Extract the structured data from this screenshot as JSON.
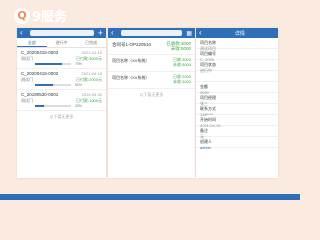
{
  "logo": {
    "mark": "Q",
    "text": "9服务"
  },
  "screen1": {
    "tabs": [
      "全部",
      "进行中",
      "已完成"
    ],
    "cards": [
      {
        "code": "C_20200415-0003",
        "date": "2021-04-15",
        "sub": "测试门",
        "amount": "已付款:3000元",
        "progress": 0.75,
        "pct": "75%"
      },
      {
        "code": "C_20200415-0002",
        "date": "2021-04-15",
        "sub": "测试门",
        "amount": "已付款:2000元",
        "progress": 0.5,
        "pct": "50%"
      },
      {
        "code": "C_20190530-0001",
        "date": "2019-05-30",
        "sub": "测试门",
        "amount": "已付款:1000元",
        "progress": 0.25,
        "pct": "25%"
      }
    ],
    "more": "以下暂无更多"
  },
  "screen2": {
    "head": {
      "title": "合同号1-OP220510",
      "right1": "已收款:3000",
      "right2": "未收:5000"
    },
    "rows": [
      {
        "label": "项目名称（XX系统）",
        "right1": "已收:3000",
        "right2": "未收:5000"
      },
      {
        "label": "项目名称（XX系统）",
        "right1": "已收:2000",
        "right2": "未收:3000"
      }
    ],
    "more": "以下暂无更多"
  },
  "screen3": {
    "title": "详情",
    "fields": [
      {
        "label": "项目名称",
        "value": "测试项目"
      },
      {
        "label": "项目编号",
        "value": "C_2020"
      },
      {
        "label": "项目状态",
        "value": "进行中"
      },
      {
        "label": "",
        "value": ""
      },
      {
        "label": "金额",
        "value": "3000"
      },
      {
        "label": "项目经理",
        "value": "张三"
      },
      {
        "label": "联系方式",
        "value": "138****"
      },
      {
        "label": "开始时间",
        "value": "2021-04-15"
      },
      {
        "label": "备注",
        "value": "无"
      },
      {
        "label": "创建人",
        "value": "admin"
      }
    ]
  }
}
